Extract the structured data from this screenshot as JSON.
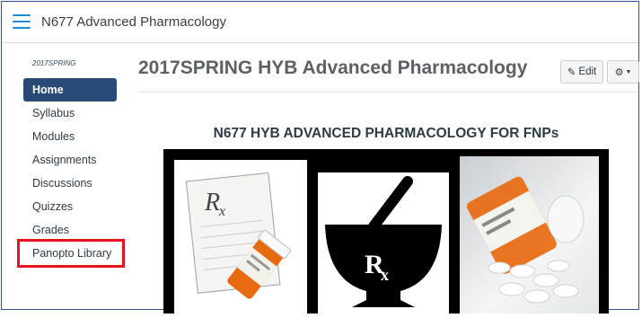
{
  "header": {
    "course_name": "N677 Advanced Pharmacology"
  },
  "sidebar": {
    "term": "2017SPRING",
    "items": [
      {
        "label": "Home"
      },
      {
        "label": "Syllabus"
      },
      {
        "label": "Modules"
      },
      {
        "label": "Assignments"
      },
      {
        "label": "Discussions"
      },
      {
        "label": "Quizzes"
      },
      {
        "label": "Grades"
      },
      {
        "label": "Panopto Library"
      }
    ]
  },
  "main": {
    "title": "2017SPRING HYB Advanced Pharmacology",
    "edit_label": "Edit",
    "banner_title": "N677 HYB ADVANCED PHARMACOLOGY FOR FNPs",
    "rx_text_1": "R",
    "rx_text_2": "R"
  },
  "colors": {
    "nav_active_bg": "#294a74",
    "hamburger": "#1b8bd6",
    "highlight": "#e5131b",
    "pill_orange": "#e86a10"
  }
}
